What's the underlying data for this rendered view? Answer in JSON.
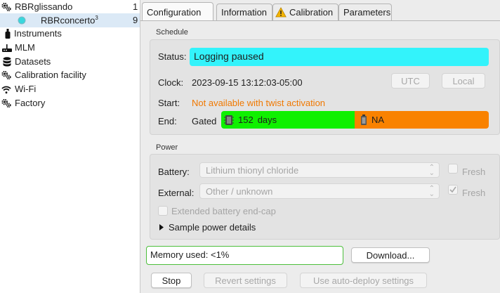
{
  "sidebar": {
    "items": [
      {
        "label": "RBRglissando",
        "num": "1",
        "icon": "gears-icon"
      },
      {
        "label": "RBRconcerto",
        "sup": "3",
        "num": "9",
        "icon": "device-dot-icon"
      },
      {
        "label": "Instruments",
        "icon": "instrument-icon"
      },
      {
        "label": "MLM",
        "icon": "router-icon"
      },
      {
        "label": "Datasets",
        "icon": "database-icon"
      },
      {
        "label": "Calibration facility",
        "icon": "gears-icon"
      },
      {
        "label": "Wi-Fi",
        "icon": "wifi-icon"
      },
      {
        "label": "Factory",
        "icon": "gears-icon"
      }
    ]
  },
  "tabs": [
    {
      "label": "Configuration"
    },
    {
      "label": "Information"
    },
    {
      "label": "Calibration",
      "icon": "warning-icon"
    },
    {
      "label": "Parameters"
    }
  ],
  "schedule": {
    "title": "Schedule",
    "status_label": "Status:",
    "status_value": "Logging paused",
    "clock_label": "Clock:",
    "clock_value": "2023-09-15 13:12:03-05:00",
    "utc_label": "UTC",
    "local_label": "Local",
    "start_label": "Start:",
    "start_value": "Not available with twist activation",
    "end_label": "End:",
    "end_value": "Gated",
    "memory_bar_value": "152",
    "memory_bar_unit": "days",
    "battery_bar_value": "NA"
  },
  "power": {
    "title": "Power",
    "battery_label": "Battery:",
    "battery_value": "Lithium thionyl chloride",
    "battery_fresh_label": "Fresh",
    "battery_fresh_checked": false,
    "external_label": "External:",
    "external_value": "Other / unknown",
    "external_fresh_label": "Fresh",
    "external_fresh_checked": true,
    "endcap_label": "Extended battery end-cap",
    "endcap_checked": false,
    "details_label": "Sample power details"
  },
  "footer": {
    "memory_used": "Memory used: <1%",
    "download_label": "Download...",
    "stop_label": "Stop",
    "revert_label": "Revert settings",
    "autodeploy_label": "Use auto-deploy settings"
  },
  "colors": {
    "status_bg": "#33f3fb",
    "start_text": "#f07800",
    "days_bar": "#0ff000",
    "battery_bar": "#f98200",
    "selected_row": "#dbe9f6",
    "memory_border": "#4cbf3b"
  }
}
